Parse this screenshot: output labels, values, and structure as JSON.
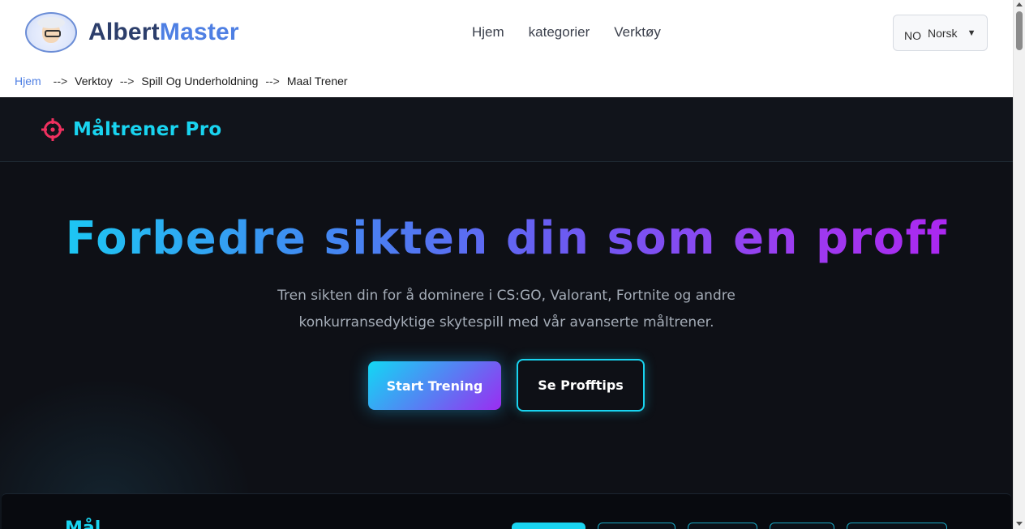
{
  "site": {
    "brand_part1": "Albert",
    "brand_part2": "Master",
    "nav": [
      "Hjem",
      "kategorier",
      "Verktøy"
    ],
    "language": {
      "code": "NO",
      "name": "Norsk",
      "caret": "▼"
    }
  },
  "breadcrumb": {
    "home": "Hjem",
    "separator": "-->",
    "items": [
      "Verktoy",
      "Spill Og Underholdning",
      "Maal Trener"
    ]
  },
  "app": {
    "title": "Måltrener Pro",
    "hero_title": "Forbedre sikten din som en proff",
    "hero_subtitle_line1": "Tren sikten din for å dominere i CS:GO, Valorant, Fortnite og andre",
    "hero_subtitle_line2": "konkurransedyktige skytespill med vår avanserte måltrener.",
    "start_button": "Start Trening",
    "tips_button": "Se Profftips",
    "panel_title_partial": "Mål"
  },
  "colors": {
    "accent_cyan": "#19d4f0",
    "accent_purple": "#a51ff0",
    "crosshair": "#f0305f",
    "brand_blue": "#4e7fe3",
    "brand_dark": "#2c3e6b",
    "app_bg": "#0f1117"
  },
  "icons": {
    "app_logo": "crosshair-icon",
    "language_caret": "caret-down-icon"
  }
}
